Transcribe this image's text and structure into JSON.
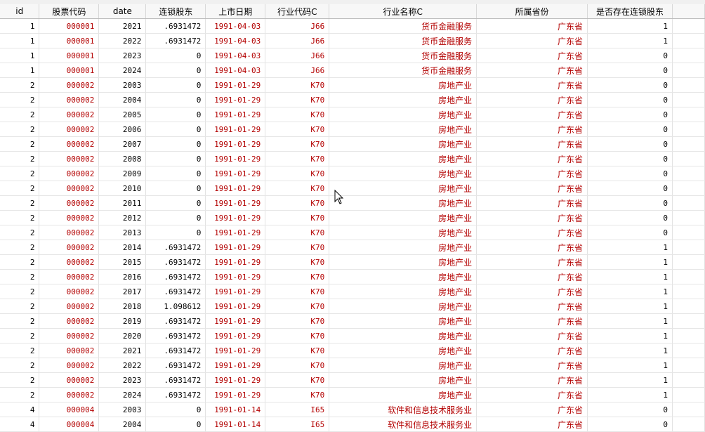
{
  "table": {
    "columns": [
      "id",
      "股票代码",
      "date",
      "连锁股东",
      "上市日期",
      "行业代码C",
      "行业名称C",
      "所属省份",
      "是否存在连锁股东"
    ],
    "rows": [
      [
        "1",
        "000001",
        "2021",
        ".6931472",
        "1991-04-03",
        "J66",
        "货币金融服务",
        "广东省",
        "1"
      ],
      [
        "1",
        "000001",
        "2022",
        ".6931472",
        "1991-04-03",
        "J66",
        "货币金融服务",
        "广东省",
        "1"
      ],
      [
        "1",
        "000001",
        "2023",
        "0",
        "1991-04-03",
        "J66",
        "货币金融服务",
        "广东省",
        "0"
      ],
      [
        "1",
        "000001",
        "2024",
        "0",
        "1991-04-03",
        "J66",
        "货币金融服务",
        "广东省",
        "0"
      ],
      [
        "2",
        "000002",
        "2003",
        "0",
        "1991-01-29",
        "K70",
        "房地产业",
        "广东省",
        "0"
      ],
      [
        "2",
        "000002",
        "2004",
        "0",
        "1991-01-29",
        "K70",
        "房地产业",
        "广东省",
        "0"
      ],
      [
        "2",
        "000002",
        "2005",
        "0",
        "1991-01-29",
        "K70",
        "房地产业",
        "广东省",
        "0"
      ],
      [
        "2",
        "000002",
        "2006",
        "0",
        "1991-01-29",
        "K70",
        "房地产业",
        "广东省",
        "0"
      ],
      [
        "2",
        "000002",
        "2007",
        "0",
        "1991-01-29",
        "K70",
        "房地产业",
        "广东省",
        "0"
      ],
      [
        "2",
        "000002",
        "2008",
        "0",
        "1991-01-29",
        "K70",
        "房地产业",
        "广东省",
        "0"
      ],
      [
        "2",
        "000002",
        "2009",
        "0",
        "1991-01-29",
        "K70",
        "房地产业",
        "广东省",
        "0"
      ],
      [
        "2",
        "000002",
        "2010",
        "0",
        "1991-01-29",
        "K70",
        "房地产业",
        "广东省",
        "0"
      ],
      [
        "2",
        "000002",
        "2011",
        "0",
        "1991-01-29",
        "K70",
        "房地产业",
        "广东省",
        "0"
      ],
      [
        "2",
        "000002",
        "2012",
        "0",
        "1991-01-29",
        "K70",
        "房地产业",
        "广东省",
        "0"
      ],
      [
        "2",
        "000002",
        "2013",
        "0",
        "1991-01-29",
        "K70",
        "房地产业",
        "广东省",
        "0"
      ],
      [
        "2",
        "000002",
        "2014",
        ".6931472",
        "1991-01-29",
        "K70",
        "房地产业",
        "广东省",
        "1"
      ],
      [
        "2",
        "000002",
        "2015",
        ".6931472",
        "1991-01-29",
        "K70",
        "房地产业",
        "广东省",
        "1"
      ],
      [
        "2",
        "000002",
        "2016",
        ".6931472",
        "1991-01-29",
        "K70",
        "房地产业",
        "广东省",
        "1"
      ],
      [
        "2",
        "000002",
        "2017",
        ".6931472",
        "1991-01-29",
        "K70",
        "房地产业",
        "广东省",
        "1"
      ],
      [
        "2",
        "000002",
        "2018",
        "1.098612",
        "1991-01-29",
        "K70",
        "房地产业",
        "广东省",
        "1"
      ],
      [
        "2",
        "000002",
        "2019",
        ".6931472",
        "1991-01-29",
        "K70",
        "房地产业",
        "广东省",
        "1"
      ],
      [
        "2",
        "000002",
        "2020",
        ".6931472",
        "1991-01-29",
        "K70",
        "房地产业",
        "广东省",
        "1"
      ],
      [
        "2",
        "000002",
        "2021",
        ".6931472",
        "1991-01-29",
        "K70",
        "房地产业",
        "广东省",
        "1"
      ],
      [
        "2",
        "000002",
        "2022",
        ".6931472",
        "1991-01-29",
        "K70",
        "房地产业",
        "广东省",
        "1"
      ],
      [
        "2",
        "000002",
        "2023",
        ".6931472",
        "1991-01-29",
        "K70",
        "房地产业",
        "广东省",
        "1"
      ],
      [
        "2",
        "000002",
        "2024",
        ".6931472",
        "1991-01-29",
        "K70",
        "房地产业",
        "广东省",
        "1"
      ],
      [
        "4",
        "000004",
        "2003",
        "0",
        "1991-01-14",
        "I65",
        "软件和信息技术服务业",
        "广东省",
        "0"
      ],
      [
        "4",
        "000004",
        "2004",
        "0",
        "1991-01-14",
        "I65",
        "软件和信息技术服务业",
        "广东省",
        "0"
      ]
    ]
  },
  "colors": {
    "string_value": "#b30000",
    "numeric_value": "#000000"
  },
  "icons": {
    "cursor": "mouse-pointer-icon"
  }
}
